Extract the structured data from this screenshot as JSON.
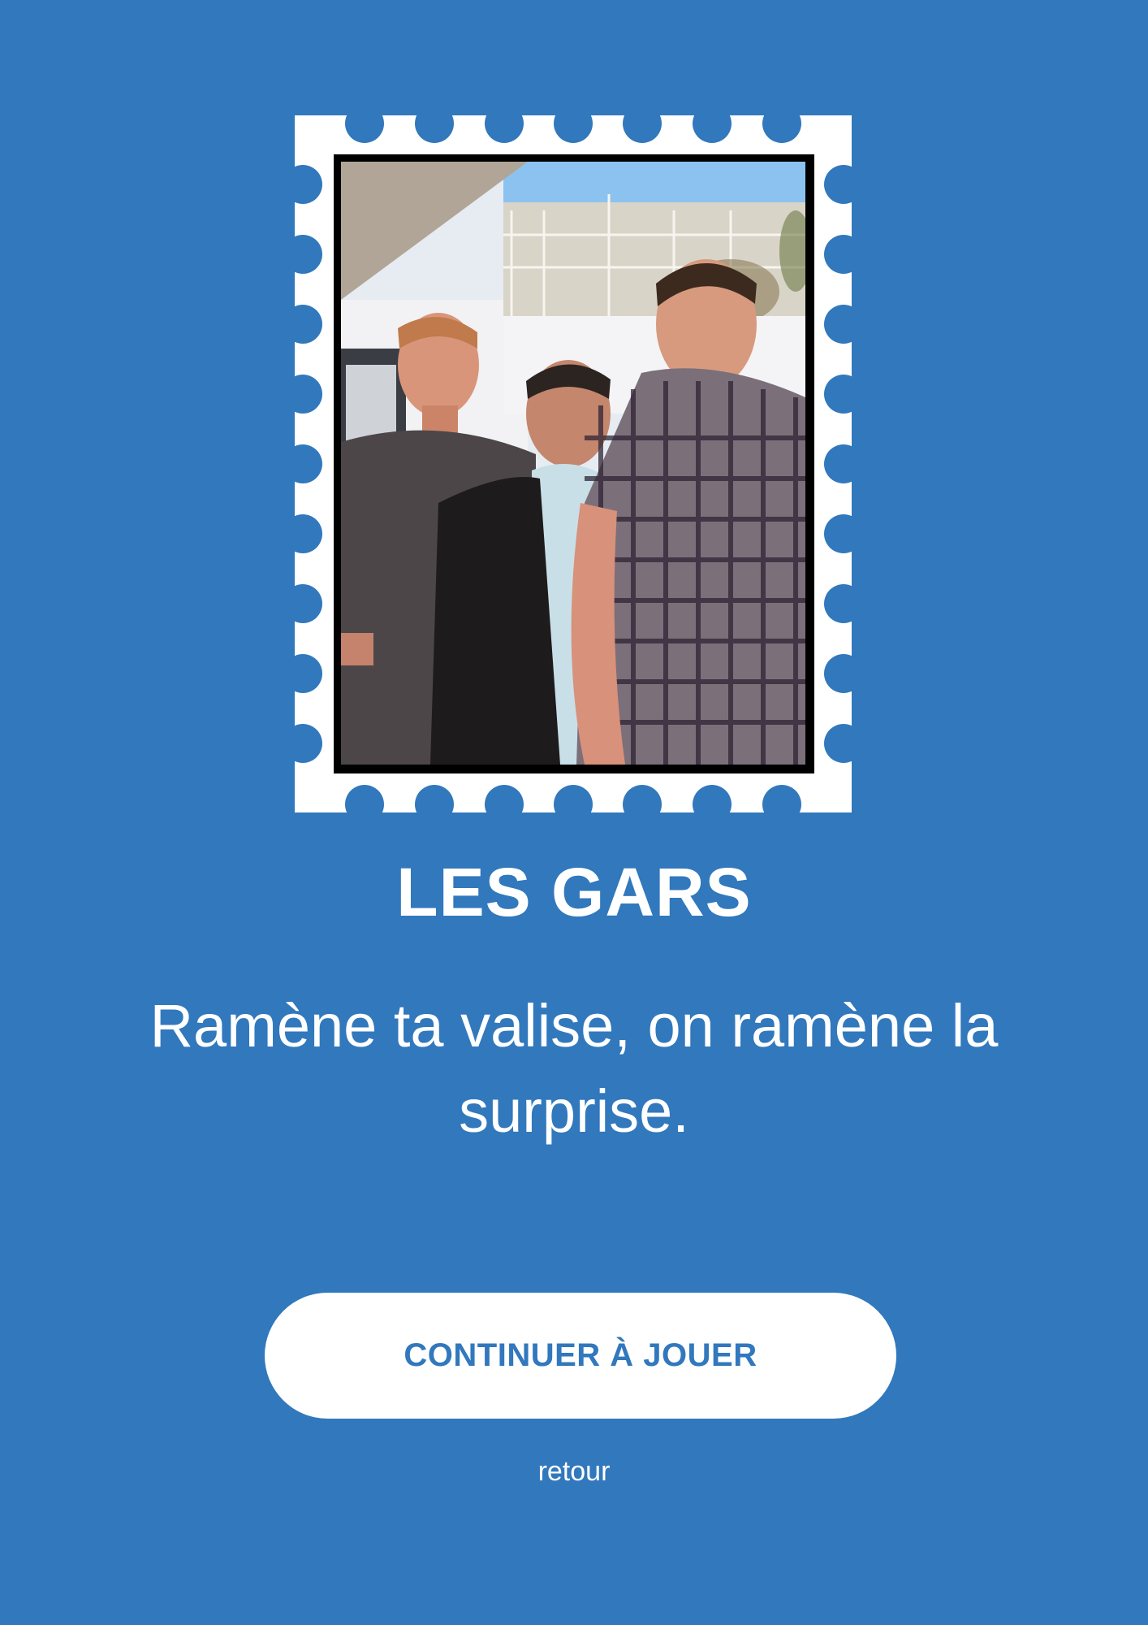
{
  "theme": {
    "background": "#3178bd",
    "foreground": "#ffffff",
    "button_background": "#ffffff",
    "button_text": "#3178bd"
  },
  "stamp": {
    "photo": {
      "description_icon": "group-photo-of-three-men",
      "people_count": 3
    }
  },
  "title": "LES GARS",
  "subtitle": "Ramène ta valise, on ramène la surprise.",
  "primary_action": {
    "label": "CONTINUER À JOUER"
  },
  "secondary_action": {
    "label": "retour"
  }
}
